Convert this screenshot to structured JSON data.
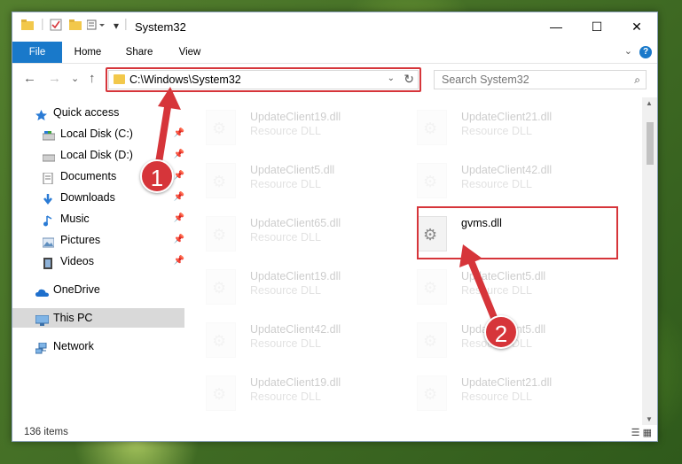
{
  "window": {
    "title": "System32",
    "minimize": "—",
    "maximize": "☐",
    "close": "✕"
  },
  "ribbon": {
    "tabs": [
      {
        "label": "File"
      },
      {
        "label": "Home"
      },
      {
        "label": "Share"
      },
      {
        "label": "View"
      }
    ],
    "help": "?",
    "expand": "⌄"
  },
  "nav": {
    "back": "←",
    "forward": "→",
    "recent": "⌄",
    "up": "↑",
    "address": "C:\\Windows\\System32",
    "address_dropdown": "⌄",
    "refresh": "↻",
    "search_placeholder": "Search System32",
    "search_icon": "⌕"
  },
  "sidebar": {
    "items": [
      {
        "label": "Quick access",
        "icon": "star-icon",
        "pinned": false
      },
      {
        "label": "Local Disk (C:)",
        "icon": "drive-icon",
        "pinned": true
      },
      {
        "label": "Local Disk (D:)",
        "icon": "drive-icon",
        "pinned": true
      },
      {
        "label": "Documents",
        "icon": "documents-icon",
        "pinned": true
      },
      {
        "label": "Downloads",
        "icon": "downloads-icon",
        "pinned": true
      },
      {
        "label": "Music",
        "icon": "music-icon",
        "pinned": true
      },
      {
        "label": "Pictures",
        "icon": "pictures-icon",
        "pinned": true
      },
      {
        "label": "Videos",
        "icon": "videos-icon",
        "pinned": true
      },
      {
        "label": "OneDrive",
        "icon": "cloud-icon",
        "pinned": false
      },
      {
        "label": "This PC",
        "icon": "computer-icon",
        "pinned": false,
        "selected": true
      },
      {
        "label": "Network",
        "icon": "network-icon",
        "pinned": false
      }
    ],
    "pin_glyph": "📌"
  },
  "files": [
    {
      "name": "UpdateClient19.dll",
      "type": "Resource DLL",
      "faded": true
    },
    {
      "name": "UpdateClient21.dll",
      "type": "Resource DLL",
      "faded": true
    },
    {
      "name": "UpdateClient5.dll",
      "type": "Resource DLL",
      "faded": true
    },
    {
      "name": "UpdateClient42.dll",
      "type": "Resource DLL",
      "faded": true
    },
    {
      "name": "UpdateClient65.dll",
      "type": "Resource DLL",
      "faded": true
    },
    {
      "name": "gvms.dll",
      "type": "",
      "faded": false
    },
    {
      "name": "UpdateClient19.dll",
      "type": "Resource DLL",
      "faded": true
    },
    {
      "name": "UpdateClient5.dll",
      "type": "Resource DLL",
      "faded": true
    },
    {
      "name": "UpdateClient42.dll",
      "type": "Resource DLL",
      "faded": true
    },
    {
      "name": "UpdateClient5.dll",
      "type": "Resource DLL",
      "faded": true
    },
    {
      "name": "UpdateClient19.dll",
      "type": "Resource DLL",
      "faded": true
    },
    {
      "name": "UpdateClient21.dll",
      "type": "Resource DLL",
      "faded": true
    }
  ],
  "status": {
    "count": "136 items",
    "view_details": "☰",
    "view_tiles": "▦"
  },
  "callouts": [
    {
      "number": "1"
    },
    {
      "number": "2"
    }
  ],
  "colors": {
    "accent": "#1979ca",
    "highlight": "#d6353a",
    "selected": "#d9d9d9"
  }
}
